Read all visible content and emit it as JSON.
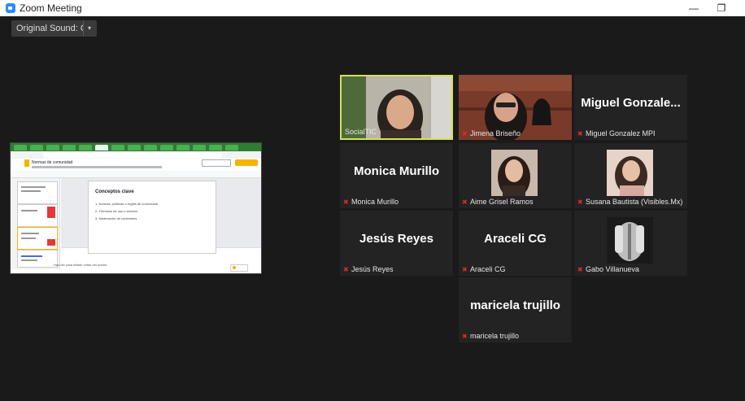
{
  "window": {
    "title": "Zoom Meeting",
    "minimize_label": "—",
    "restore_label": "❐"
  },
  "sound": {
    "label": "Original Sound: Off",
    "caret": "▾"
  },
  "share": {
    "doc_name": "Normas de comunidad",
    "slide_title": "Conceptos clave",
    "slide_items": [
      "1.  Normas, políticas o reglas de comunidad",
      "2.  Términos de uso o servicio",
      "3.  Moderación de contenidos"
    ],
    "notes_text": "Haz clic para añadir notas del orador"
  },
  "participants": [
    {
      "name": "SocialTIC",
      "muted": false,
      "video": true,
      "active": true
    },
    {
      "name": "Jimena Briseño",
      "muted": true,
      "video": true,
      "active": false
    },
    {
      "name": "Miguel Gonzalez MPI",
      "display": "Miguel  Gonzale...",
      "muted": true,
      "video": false
    },
    {
      "name": "Monica Murillo",
      "display": "Monica Murillo",
      "muted": true,
      "video": false
    },
    {
      "name": "Aime Grisel Ramos",
      "muted": true,
      "avatar": true
    },
    {
      "name": "Susana Bautista (Visibles.Mx)",
      "muted": true,
      "avatar": true
    },
    {
      "name": "Jesús Reyes",
      "display": "Jesús Reyes",
      "muted": true,
      "video": false
    },
    {
      "name": "Araceli CG",
      "display": "Araceli CG",
      "muted": true,
      "video": false
    },
    {
      "name": "Gabo Villanueva",
      "muted": true,
      "avatar": true
    },
    {
      "name": "maricela trujillo",
      "display": "maricela trujillo",
      "muted": true,
      "video": false
    }
  ]
}
